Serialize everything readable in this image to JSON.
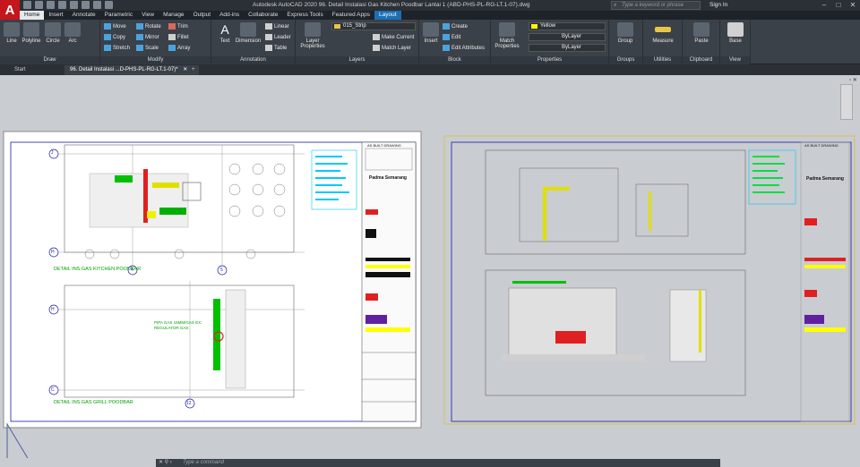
{
  "app": {
    "title": "Autodesk AutoCAD 2020   96. Detail Instalasi Gas Kitchen Poodbar Lantai 1 (ABD-PHS-PL-RG-LT.1-07).dwg",
    "logo_letter": "A"
  },
  "search": {
    "placeholder": "Type a keyword or phrase"
  },
  "account": {
    "signin": "Sign In"
  },
  "ribbon_tabs": [
    "Home",
    "Insert",
    "Annotate",
    "Parametric",
    "View",
    "Manage",
    "Output",
    "Add-ins",
    "Collaborate",
    "Express Tools",
    "Featured Apps",
    "Layout"
  ],
  "panels": {
    "draw": {
      "title": "Draw",
      "tools": [
        "Line",
        "Polyline",
        "Circle",
        "Arc"
      ]
    },
    "modify": {
      "title": "Modify",
      "tools": [
        "Move",
        "Rotate",
        "Trim",
        "Copy",
        "Mirror",
        "Fillet",
        "Stretch",
        "Scale",
        "Array"
      ]
    },
    "annotation": {
      "title": "Annotation",
      "tools": [
        "Text",
        "Dimension",
        "Linear",
        "Leader",
        "Table"
      ]
    },
    "layers": {
      "title": "Layers",
      "tools": [
        "Layer Properties",
        "Make Current",
        "Match Layer"
      ],
      "current_layer": "015_Strip"
    },
    "block": {
      "title": "Block",
      "tools": [
        "Insert",
        "Create",
        "Edit",
        "Edit Attributes"
      ]
    },
    "properties": {
      "title": "Properties",
      "match": "Match Properties",
      "color": "Yellow",
      "linetype": "ByLayer",
      "lineweight": "ByLayer"
    },
    "groups": {
      "title": "Groups",
      "tool": "Group"
    },
    "utilities": {
      "title": "Utilities",
      "tool": "Measure"
    },
    "clipboard": {
      "title": "Clipboard",
      "tool": "Paste"
    },
    "view": {
      "title": "View",
      "tool": "Base"
    }
  },
  "doc_tabs": {
    "start": "Start",
    "active": "96. Detail Instalasi ...D-PHS-PL-RG-LT.1-07)*"
  },
  "sheet_left": {
    "title_top": "DETAIL INS.GAS KITCHEN POODBAR",
    "title_bottom": "DETAIL INS.GAS GRILL POODBAR",
    "note": "PIPA GAS 15MM/GAS EX. REGULATOR GAS",
    "grid_labels": [
      "J",
      "H",
      "H",
      "C",
      "4",
      "5",
      "12"
    ],
    "project": "Padma Semarang",
    "drawing_header": "AS BUILT DRAWING"
  },
  "sheet_right": {
    "project": "Padma Semarang",
    "drawing_header": "AS BUILT DRAWING"
  },
  "command": {
    "placeholder": "Type a command"
  },
  "colors": {
    "accent": "#1a6fb5",
    "logo": "#c4161c",
    "ribbon": "#3b4148",
    "canvas": "#c9ccd0"
  }
}
